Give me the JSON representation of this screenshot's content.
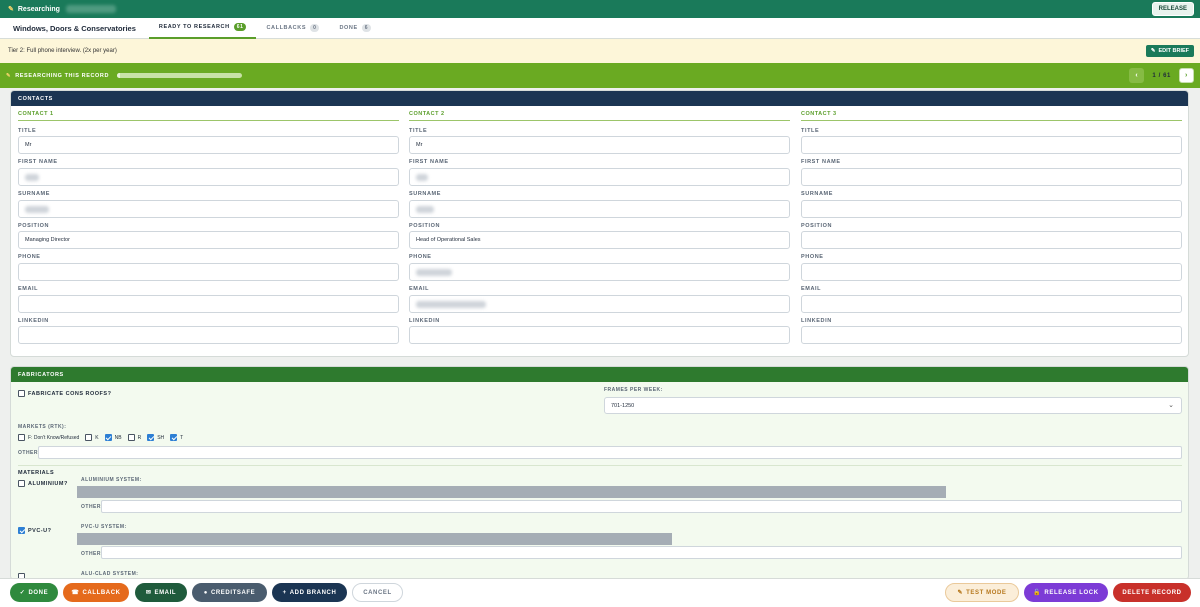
{
  "header": {
    "title": "Researching",
    "release_label": "RELEASE"
  },
  "tabs": {
    "category": "Windows, Doors & Conservatories",
    "items": [
      {
        "label": "READY TO RESEARCH",
        "count": "61"
      },
      {
        "label": "CALLBACKS",
        "count": "0"
      },
      {
        "label": "DONE",
        "count": "6"
      }
    ]
  },
  "tier": {
    "text": "Tier 2: Full phone interview. (2x per year)",
    "edit_label": "EDIT BRIEF"
  },
  "research": {
    "label": "RESEARCHING THIS RECORD",
    "progress": 0.02,
    "pager": "1 / 61"
  },
  "contacts": {
    "header": "CONTACTS",
    "labels": {
      "title": "TITLE",
      "first": "FIRST NAME",
      "surname": "SURNAME",
      "position": "POSITION",
      "phone": "PHONE",
      "email": "EMAIL",
      "linkedin": "LINKEDIN"
    },
    "c1": {
      "head": "CONTACT 1",
      "title": "Mr",
      "position": "Managing Director"
    },
    "c2": {
      "head": "CONTACT 2",
      "title": "Mr",
      "position": "Head of Operational Sales"
    },
    "c3": {
      "head": "CONTACT 3",
      "title": "",
      "position": ""
    }
  },
  "fabricators": {
    "header": "FABRICATORS",
    "cons_roofs_label": "FABRICATE CONS ROOFS?",
    "frames_label": "FRAMES PER WEEK:",
    "frames_value": "701-1250",
    "markets_label": "MARKETS (RTK):",
    "markets": [
      {
        "label": "F: Don't Know/Refused",
        "checked": false
      },
      {
        "label": "K",
        "checked": false
      },
      {
        "label": "NB",
        "checked": true
      },
      {
        "label": "R",
        "checked": false
      },
      {
        "label": "SH",
        "checked": true
      },
      {
        "label": "T",
        "checked": true
      }
    ],
    "other_label": "OTHER:",
    "materials_label": "MATERIALS",
    "aluminium_label": "ALUMINIUM?",
    "aluminium_system_label": "ALUMINIUM SYSTEM:",
    "pvcu_label": "PVC-U?",
    "pvcu_system_label": "PVC-U SYSTEM:",
    "alu_clad_label": "ALU-CLAD SYSTEM:"
  },
  "actions": {
    "done": "DONE",
    "callback": "CALLBACK",
    "email": "EMAIL",
    "creditsafe": "CREDITSAFE",
    "add_branch": "ADD BRANCH",
    "cancel": "CANCEL",
    "test_mode": "TEST MODE",
    "release_lock": "RELEASE LOCK",
    "delete": "DELETE RECORD"
  },
  "colors": {
    "brand": "#1a7a5a",
    "accent": "#6aaa22",
    "navy": "#1b3553"
  }
}
